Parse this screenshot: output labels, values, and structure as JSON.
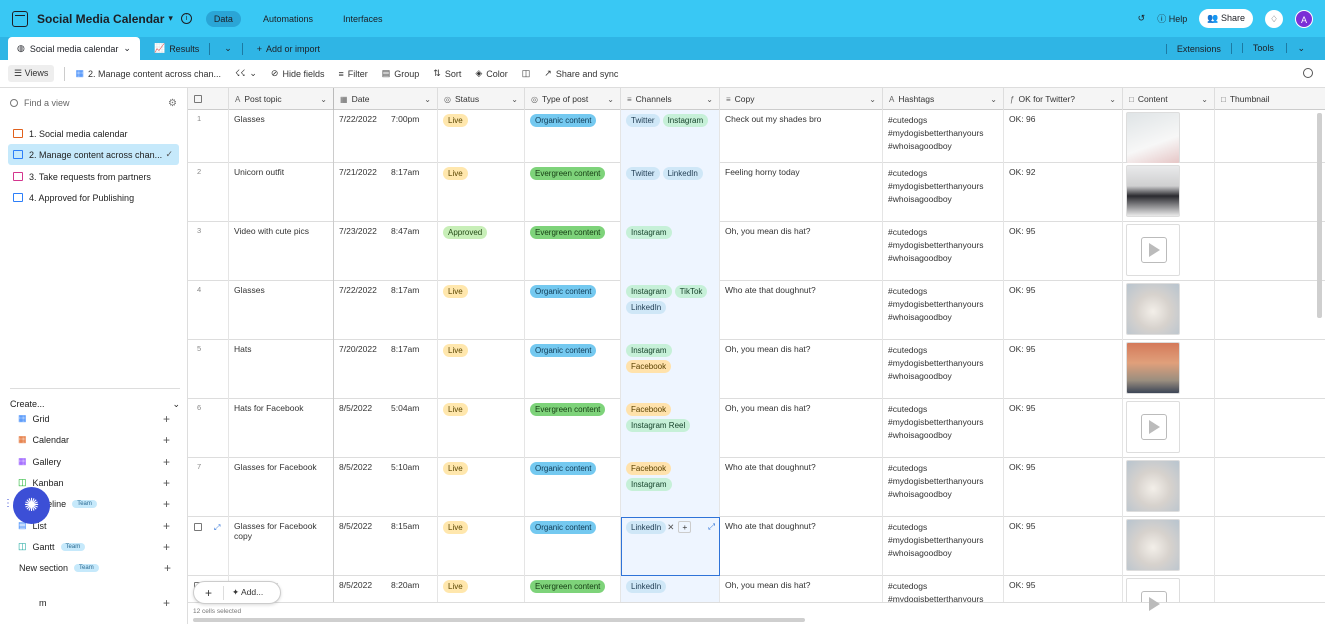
{
  "app": {
    "base_name": "Social Media Calendar",
    "top_tabs": [
      "Data",
      "Automations",
      "Interfaces"
    ],
    "active_top_tab": "Data",
    "help": "Help",
    "share": "Share",
    "avatar_initial": "A",
    "accent": "#39c8f4"
  },
  "tabbar": {
    "active_table": "Social media calendar",
    "results": "Results",
    "add_import": "Add or import",
    "extensions": "Extensions",
    "tools": "Tools"
  },
  "viewbar": {
    "views": "Views",
    "current_view": "2. Manage content across chan...",
    "hide_fields": "Hide fields",
    "filter": "Filter",
    "group": "Group",
    "sort": "Sort",
    "color": "Color",
    "share_sync": "Share and sync"
  },
  "sidebar": {
    "find_placeholder": "Find a view",
    "views": [
      {
        "label": "1. Social media calendar",
        "icon": "calendar-icon"
      },
      {
        "label": "2. Manage content across chan...",
        "icon": "grid-icon"
      },
      {
        "label": "3. Take requests from partners",
        "icon": "form-icon"
      },
      {
        "label": "4. Approved for Publishing",
        "icon": "grid-icon"
      }
    ],
    "create_label": "Create...",
    "create_items": [
      {
        "label": "Grid",
        "badge": ""
      },
      {
        "label": "Calendar",
        "badge": ""
      },
      {
        "label": "Gallery",
        "badge": ""
      },
      {
        "label": "Kanban",
        "badge": ""
      },
      {
        "label": "Timeline",
        "badge": "Team"
      },
      {
        "label": "List",
        "badge": ""
      },
      {
        "label": "Gantt",
        "badge": "Team"
      },
      {
        "label": "New section",
        "badge": "Team"
      }
    ],
    "hidden_last": "m"
  },
  "grid": {
    "columns": [
      "Post topic",
      "Date",
      "Status",
      "Type of post",
      "Channels",
      "Copy",
      "Hashtags",
      "OK for Twitter?",
      "Content",
      "Thumbnail"
    ],
    "rows": [
      {
        "n": "1",
        "topic": "Glasses",
        "date": "7/22/2022",
        "time": "7:00pm",
        "status": "Live",
        "type": "Organic content",
        "channels": [
          "Twitter",
          "Instagram"
        ],
        "copy": "Check out my shades bro",
        "tags": [
          "#cutedogs",
          "#mydogisbetterthanyours",
          "#whoisagoodboy"
        ],
        "ok": "OK: 96",
        "thumb": "dog-w"
      },
      {
        "n": "2",
        "topic": "Unicorn outfit",
        "date": "7/21/2022",
        "time": "8:17am",
        "status": "Live",
        "type": "Evergreen content",
        "channels": [
          "Twitter",
          "LinkedIn"
        ],
        "copy": "Feeling horny today",
        "tags": [
          "#cutedogs",
          "#mydogisbetterthanyours",
          "#whoisagoodboy"
        ],
        "ok": "OK: 92",
        "thumb": "dog-s"
      },
      {
        "n": "3",
        "topic": "Video with cute pics",
        "date": "7/23/2022",
        "time": "8:47am",
        "status": "Approved",
        "type": "Evergreen content",
        "channels": [
          "Instagram"
        ],
        "copy": "Oh, you mean dis hat?",
        "tags": [
          "#cutedogs",
          "#mydogisbetterthanyours",
          "#whoisagoodboy"
        ],
        "ok": "OK: 95",
        "thumb": "video"
      },
      {
        "n": "4",
        "topic": "Glasses",
        "date": "7/22/2022",
        "time": "8:17am",
        "status": "Live",
        "type": "Organic content",
        "channels": [
          "Instagram",
          "TikTok",
          "LinkedIn"
        ],
        "copy": "Who ate that doughnut?",
        "tags": [
          "#cutedogs",
          "#mydogisbetterthanyours",
          "#whoisagoodboy"
        ],
        "ok": "OK: 95",
        "thumb": "dog-g"
      },
      {
        "n": "5",
        "topic": "Hats",
        "date": "7/20/2022",
        "time": "8:17am",
        "status": "Live",
        "type": "Organic content",
        "channels": [
          "Instagram",
          "Facebook"
        ],
        "copy": "Oh, you mean dis hat?",
        "tags": [
          "#cutedogs",
          "#mydogisbetterthanyours",
          "#whoisagoodboy"
        ],
        "ok": "OK: 95",
        "thumb": "dog-h"
      },
      {
        "n": "6",
        "topic": "Hats for Facebook",
        "date": "8/5/2022",
        "time": "5:04am",
        "status": "Live",
        "type": "Evergreen content",
        "channels": [
          "Facebook",
          "Instagram Reel"
        ],
        "copy": "Oh, you mean dis hat?",
        "tags": [
          "#cutedogs",
          "#mydogisbetterthanyours",
          "#whoisagoodboy"
        ],
        "ok": "OK: 95",
        "thumb": "video"
      },
      {
        "n": "7",
        "topic": "Glasses for Facebook",
        "date": "8/5/2022",
        "time": "5:10am",
        "status": "Live",
        "type": "Organic content",
        "channels": [
          "Facebook",
          "Instagram"
        ],
        "copy": "Who ate that doughnut?",
        "tags": [
          "#cutedogs",
          "#mydogisbetterthanyours",
          "#whoisagoodboy"
        ],
        "ok": "OK: 95",
        "thumb": "dog-g"
      },
      {
        "n": "",
        "topic": "Glasses for Facebook copy",
        "date": "8/5/2022",
        "time": "8:15am",
        "status": "Live",
        "type": "Organic content",
        "channels": [
          "LinkedIn"
        ],
        "copy": "Who ate that doughnut?",
        "tags": [
          "#cutedogs",
          "#mydogisbetterthanyours",
          "#whoisagoodboy"
        ],
        "ok": "OK: 95",
        "thumb": "dog-g"
      },
      {
        "n": "",
        "topic": "ebook copy",
        "date": "8/5/2022",
        "time": "8:20am",
        "status": "Live",
        "type": "Evergreen content",
        "channels": [
          "LinkedIn"
        ],
        "copy": "Oh, you mean dis hat?",
        "tags": [
          "#cutedogs",
          "#mydogisbetterthanyours",
          "#whoisagoodboy"
        ],
        "ok": "OK: 95",
        "thumb": "video"
      }
    ],
    "selection_status": "12 cells selected",
    "add_label": "Add..."
  }
}
